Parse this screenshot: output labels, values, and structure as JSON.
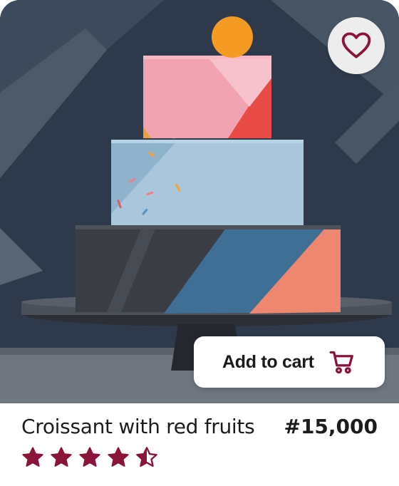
{
  "product": {
    "name": "Croissant with red fruits",
    "price": "#15,000",
    "rating": 4.5,
    "rating_max": 5
  },
  "actions": {
    "add_to_cart_label": "Add to cart"
  },
  "icons": {
    "favorite": "heart-outline-icon",
    "cart": "shopping-cart-icon",
    "star_full": "star-icon",
    "star_half": "star-half-icon"
  },
  "colors": {
    "accent": "#8a1538",
    "favorite_bg": "#ededed",
    "text": "#1c1c1c"
  }
}
